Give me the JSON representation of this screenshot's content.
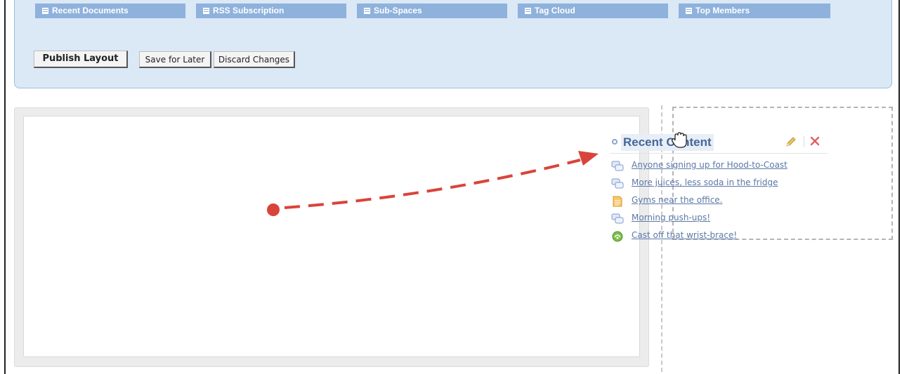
{
  "widget_tabs": [
    {
      "label": "Recent Documents"
    },
    {
      "label": "RSS Subscription"
    },
    {
      "label": "Sub-Spaces"
    },
    {
      "label": "Tag Cloud"
    },
    {
      "label": "Top Members"
    }
  ],
  "buttons": {
    "publish": "Publish Layout",
    "save": "Save for Later",
    "discard": "Discard Changes"
  },
  "widget": {
    "title": "Recent Content",
    "items": [
      {
        "text": "Anyone signing up for Hood-to-Coast",
        "icon": "discussion-icon"
      },
      {
        "text": "More juices, less soda in the fridge",
        "icon": "discussion-icon"
      },
      {
        "text": "Gyms near the office.",
        "icon": "document-icon"
      },
      {
        "text": "Morning push-ups!",
        "icon": "discussion-icon"
      },
      {
        "text": "Cast off that wrist-brace!",
        "icon": "status-update-icon"
      }
    ]
  },
  "colors": {
    "panel_bg": "#dbe8f6",
    "tab_bg": "#8eb2dc",
    "link": "#5b78a8",
    "arrow": "#d9443a"
  }
}
